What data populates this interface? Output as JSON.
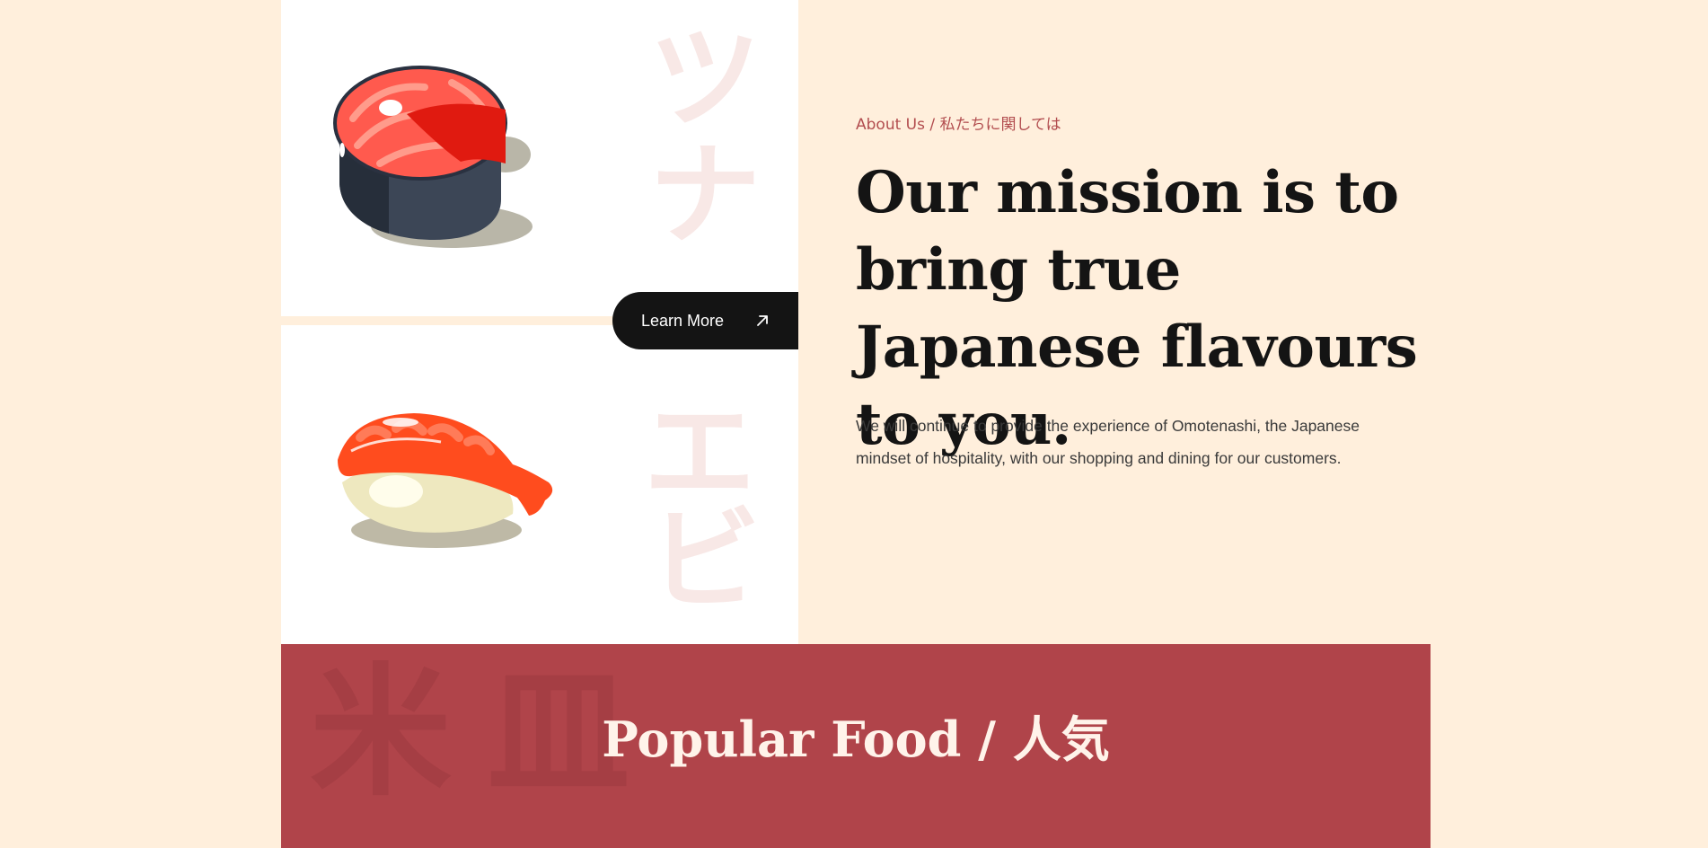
{
  "about": {
    "eyebrow": "About Us / 私たちに関しては",
    "headline": "Our mission is to bring true Japanese flavours to you.",
    "body": "We will continue to provide the experience of Omotenashi, the Japanese mindset of hospitality, with our shopping and dining for our customers.",
    "learn_more_label": "Learn More",
    "learn_more_icon": "arrow-up-right-icon"
  },
  "images": {
    "top": {
      "icon": "salmon-steak-icon",
      "kana": [
        "ツ",
        "ナ"
      ]
    },
    "bottom": {
      "icon": "shrimp-sushi-icon",
      "kana": [
        "エ",
        "ビ"
      ]
    }
  },
  "popular": {
    "title": "Popular Food / 人気",
    "watermark": [
      "米",
      "皿"
    ]
  },
  "colors": {
    "background": "#FFEFDC",
    "accent_red": "#B0444A",
    "eyebrow": "#B24D4F",
    "button_bg": "#141414",
    "kana_watermark": "#F8E8E6"
  }
}
